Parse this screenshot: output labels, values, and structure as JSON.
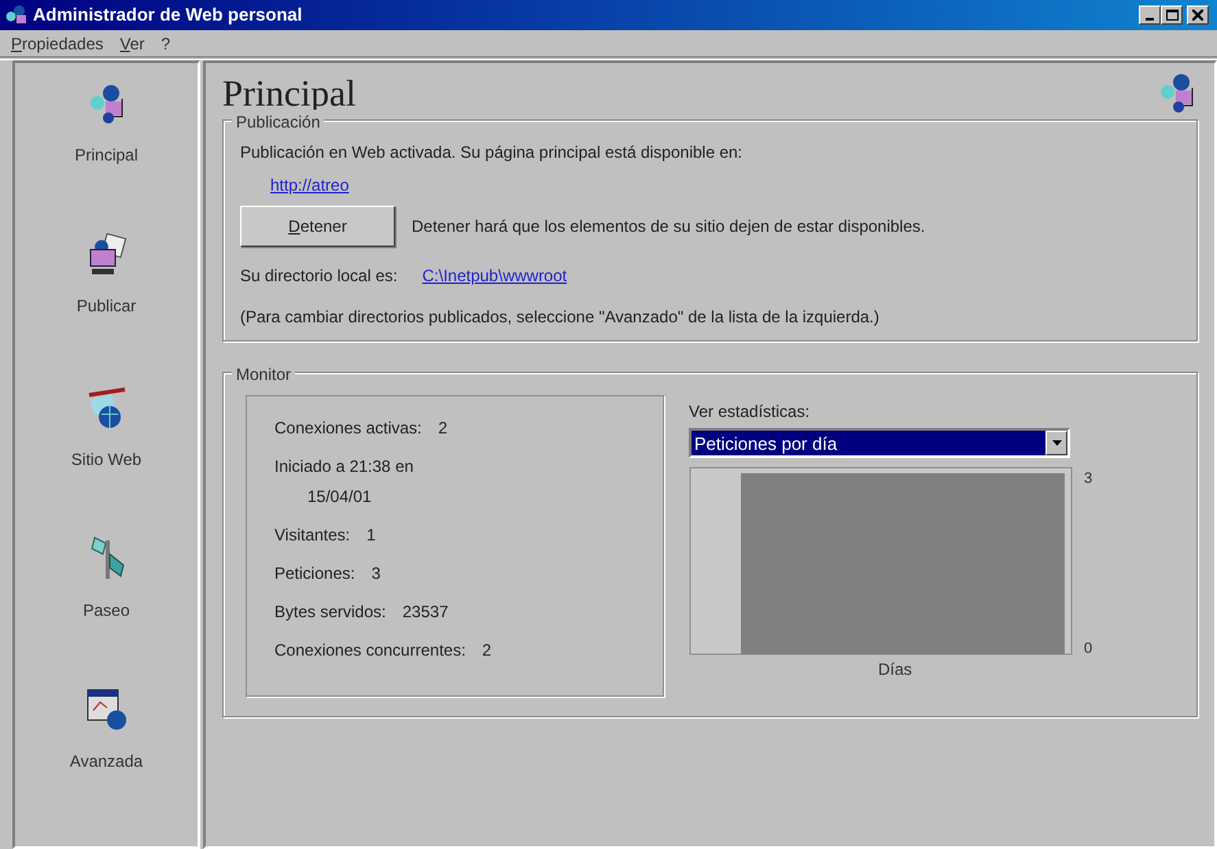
{
  "window": {
    "title": "Administrador de Web personal"
  },
  "menu": [
    {
      "label": "Propiedades"
    },
    {
      "label": "Ver"
    },
    {
      "label": "?"
    }
  ],
  "sidebar": {
    "items": [
      {
        "label": "Principal"
      },
      {
        "label": "Publicar"
      },
      {
        "label": "Sitio Web"
      },
      {
        "label": "Paseo"
      },
      {
        "label": "Avanzada"
      }
    ]
  },
  "main": {
    "title": "Principal",
    "publication": {
      "legend": "Publicación",
      "status": "Publicación en Web activada. Su página principal está disponible en:",
      "url": "http://atreo",
      "button": "Detener",
      "button_note": "Detener hará que los elementos de su sitio dejen de estar disponibles.",
      "dir_label": "Su directorio local es:",
      "dir": "C:\\Inetpub\\wwwroot",
      "hint": "(Para cambiar directorios publicados, seleccione \"Avanzado\" de la lista de la izquierda.)"
    },
    "monitor": {
      "legend": "Monitor",
      "stats": [
        {
          "kind": "inline",
          "label": "Conexiones activas:",
          "value": "2"
        },
        {
          "kind": "wrapped",
          "label": "Iniciado a 21:38 en",
          "value": "15/04/01"
        },
        {
          "kind": "inline",
          "label": "Visitantes:",
          "value": "1"
        },
        {
          "kind": "inline",
          "label": "Peticiones:",
          "value": "3"
        },
        {
          "kind": "inline",
          "label": "Bytes servidos:",
          "value": "23537"
        },
        {
          "kind": "inline",
          "label": "Conexiones concurrentes:",
          "value": "2"
        }
      ],
      "stats_label": "Ver estadísticas:",
      "stats_select": {
        "value": "Peticiones por día"
      },
      "chart": {
        "axis_max": "3",
        "axis_min": "0",
        "xlabel": "Días"
      }
    }
  }
}
